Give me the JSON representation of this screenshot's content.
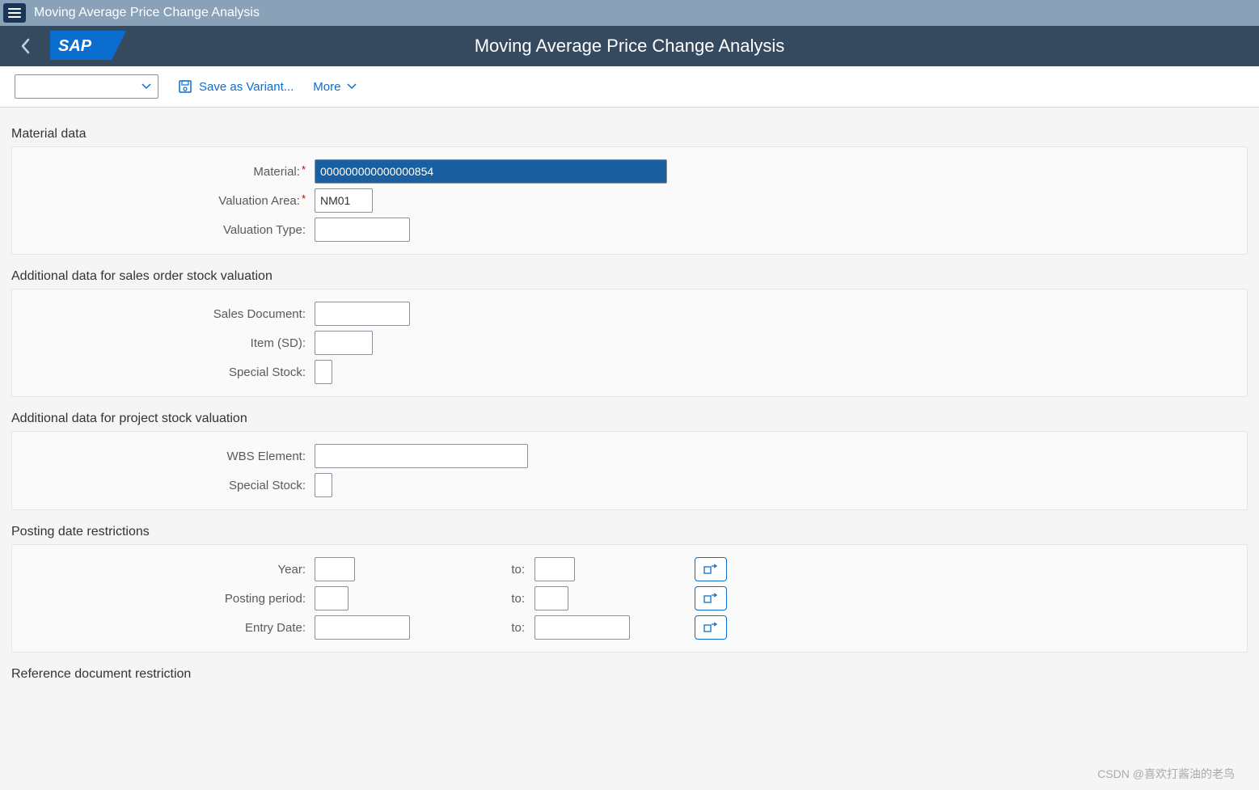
{
  "sysbar": {
    "title": "Moving Average Price Change Analysis"
  },
  "shell": {
    "title": "Moving Average Price Change Analysis"
  },
  "toolbar": {
    "save_variant": "Save as Variant...",
    "more": "More"
  },
  "groups": {
    "material": {
      "title": "Material data",
      "fields": {
        "material": {
          "label": "Material:",
          "value": "000000000000000854",
          "required": true
        },
        "valuation_area": {
          "label": "Valuation Area:",
          "value": "NM01",
          "required": true
        },
        "valuation_type": {
          "label": "Valuation Type:",
          "value": ""
        }
      }
    },
    "sales_stock": {
      "title": "Additional data for sales order stock valuation",
      "fields": {
        "sales_document": {
          "label": "Sales Document:",
          "value": ""
        },
        "item_sd": {
          "label": "Item (SD):",
          "value": ""
        },
        "special_stock": {
          "label": "Special Stock:",
          "value": ""
        }
      }
    },
    "project_stock": {
      "title": "Additional data for project stock valuation",
      "fields": {
        "wbs_element": {
          "label": "WBS Element:",
          "value": ""
        },
        "special_stock": {
          "label": "Special Stock:",
          "value": ""
        }
      }
    },
    "posting_date": {
      "title": "Posting date restrictions",
      "to_label": "to:",
      "rows": {
        "year": {
          "label": "Year:",
          "from": "",
          "to": ""
        },
        "posting_period": {
          "label": "Posting period:",
          "from": "",
          "to": ""
        },
        "entry_date": {
          "label": "Entry Date:",
          "from": "",
          "to": ""
        }
      }
    },
    "ref_doc": {
      "title": "Reference document restriction"
    }
  },
  "watermark": "CSDN @喜欢打酱油的老鸟"
}
